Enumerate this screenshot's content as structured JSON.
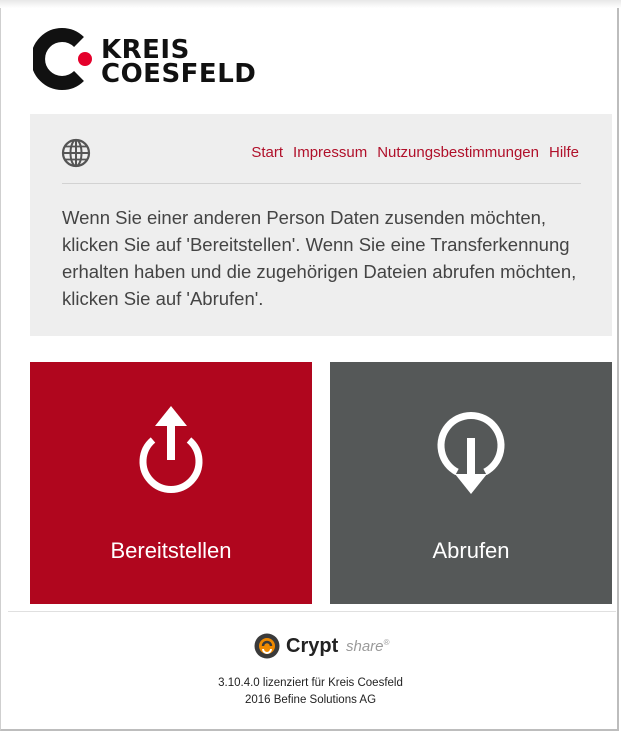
{
  "logo": {
    "line1": "KREIS",
    "line2": "COESFELD",
    "brand_color": "#e4002b"
  },
  "nav": {
    "items": [
      {
        "label": "Start"
      },
      {
        "label": "Impressum"
      },
      {
        "label": "Nutzungsbestimmungen"
      },
      {
        "label": "Hilfe"
      }
    ],
    "link_color": "#b0102a"
  },
  "info": {
    "text": "Wenn Sie einer anderen Person Daten zusenden möchten, klicken Sie auf 'Bereitstellen'. Wenn Sie eine Transferkennung erhalten haben und die zugehörigen Dateien abrufen möchten, klicken Sie auf 'Abrufen'."
  },
  "tiles": {
    "send": {
      "label": "Bereitstellen",
      "icon": "upload-power-icon",
      "color": "#b0061e"
    },
    "get": {
      "label": "Abrufen",
      "icon": "download-power-icon",
      "color": "#555858"
    }
  },
  "footer": {
    "brand_name": "Crypt",
    "brand_suffix": "share",
    "brand_mark": "®",
    "license_line": "3.10.4.0 lizenziert für Kreis Coesfeld",
    "copyright_line": "2016 Befine Solutions AG"
  }
}
